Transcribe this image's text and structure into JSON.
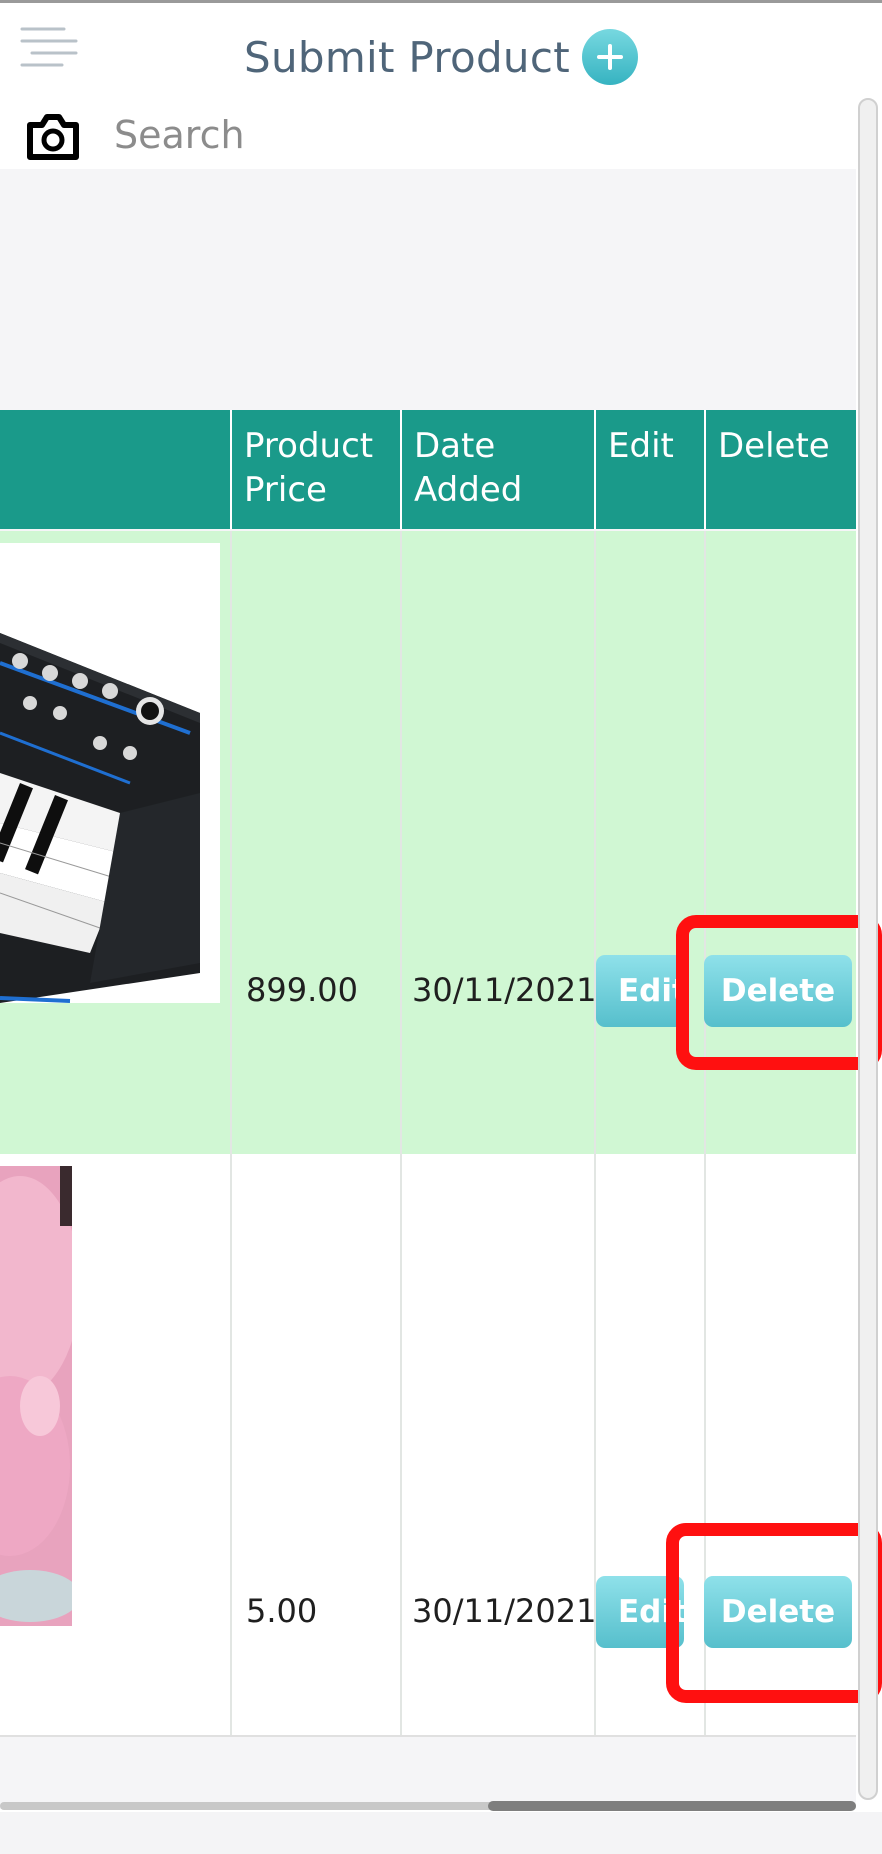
{
  "header": {
    "title": "Submit Product",
    "menu_icon": "menu-lines-icon",
    "add_icon": "plus-circle-icon",
    "accent": "#36b3c1"
  },
  "search": {
    "camera_icon": "camera-icon",
    "placeholder": "Search",
    "value": ""
  },
  "table": {
    "header_color": "#1a9a8a",
    "columns": [
      {
        "line1": "Product",
        "line2": "Price"
      },
      {
        "line1": "Date",
        "line2": "Added"
      },
      {
        "line1": "Edit",
        "line2": ""
      },
      {
        "line1": "Delete",
        "line2": ""
      }
    ],
    "rows": [
      {
        "image": "synthesizer-keyboard-image",
        "price": "899.00",
        "date": "30/11/2021",
        "edit_label": "Edit",
        "delete_label": "Delete",
        "row_color": "#d0f7d3"
      },
      {
        "image": "pink-plush-toy-image",
        "price": "5.00",
        "date": "30/11/2021",
        "edit_label": "Edit",
        "delete_label": "Delete",
        "row_color": "#ffffff"
      }
    ]
  },
  "highlight_color": "#ff1010"
}
